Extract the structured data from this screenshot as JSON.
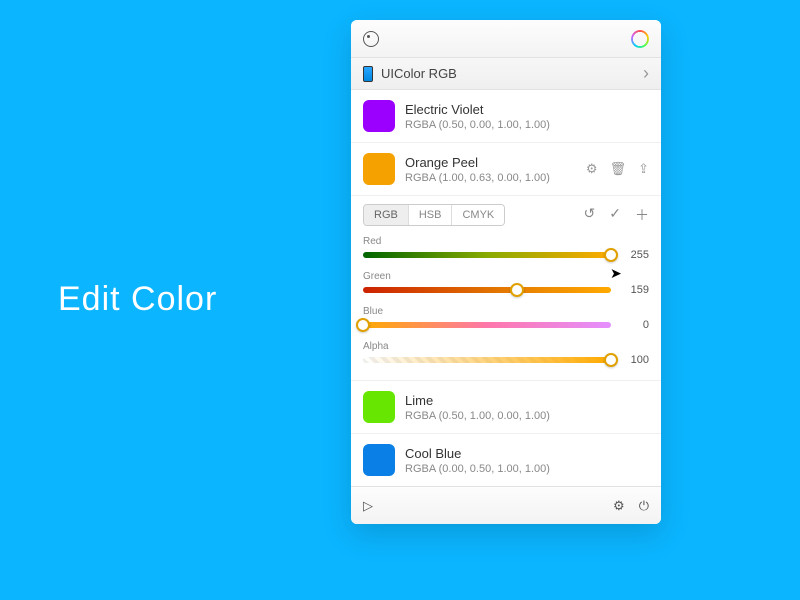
{
  "hero": "Edit Color",
  "format_label": "UIColor RGB",
  "colors": [
    {
      "name": "Electric Violet",
      "code": "RGBA (0.50, 0.00, 1.00, 1.00)",
      "hex": "#9b00ff"
    },
    {
      "name": "Orange Peel",
      "code": "RGBA (1.00, 0.63, 0.00, 1.00)",
      "hex": "#f5a100"
    },
    {
      "name": "Lime",
      "code": "RGBA (0.50, 1.00, 0.00, 1.00)",
      "hex": "#66e600"
    },
    {
      "name": "Cool Blue",
      "code": "RGBA (0.00, 0.50, 1.00, 1.00)",
      "hex": "#0a7fe5"
    }
  ],
  "modes": {
    "rgb": "RGB",
    "hsb": "HSB",
    "cmyk": "CMYK",
    "active": "rgb"
  },
  "sliders": {
    "red": {
      "label": "Red",
      "value": "255",
      "pct": 100
    },
    "green": {
      "label": "Green",
      "value": "159",
      "pct": 62
    },
    "blue": {
      "label": "Blue",
      "value": "0",
      "pct": 0
    },
    "alpha": {
      "label": "Alpha",
      "value": "100",
      "pct": 100
    }
  }
}
